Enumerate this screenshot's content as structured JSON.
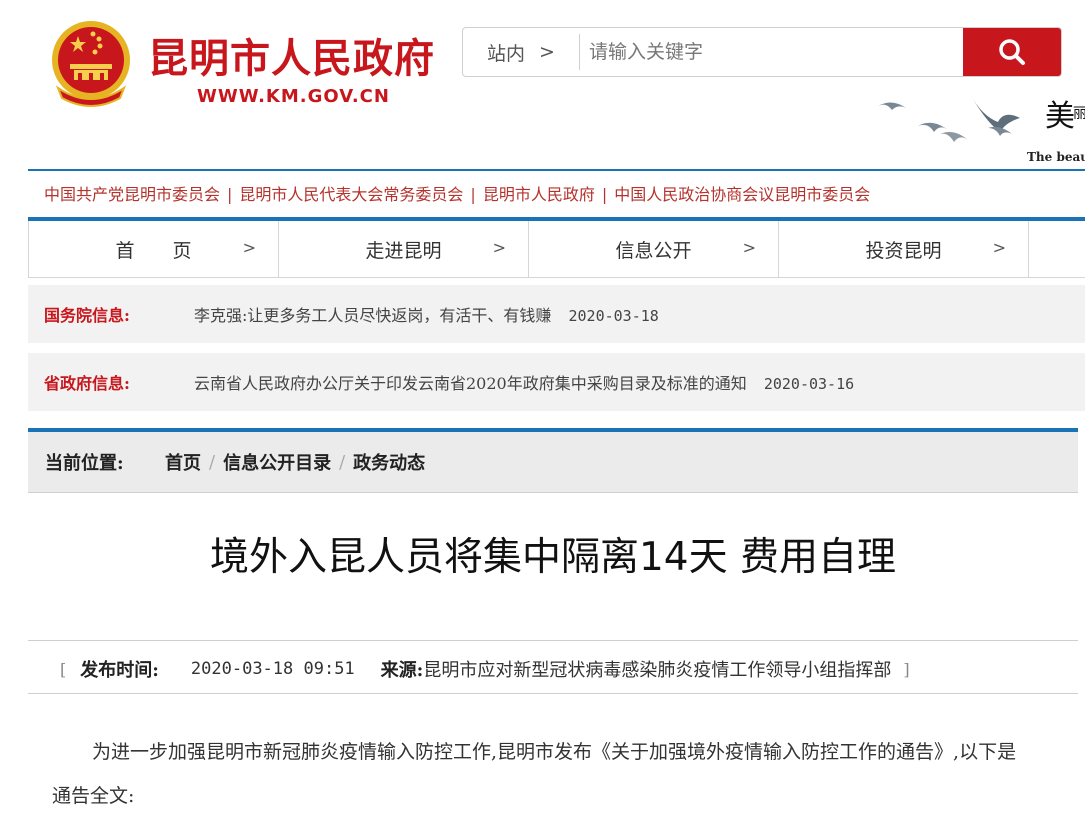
{
  "header": {
    "site_title": "昆明市人民政府",
    "site_url": "WWW.KM.GOV.CN",
    "tagline": "The beau",
    "search": {
      "scope_label": "站内",
      "scope_chevron": ">",
      "placeholder": "请输入关键字"
    }
  },
  "org_links": [
    "中国共产党昆明市委员会",
    "昆明市人民代表大会常务委员会",
    "昆明市人民政府",
    "中国人民政治协商会议昆明市委员会"
  ],
  "org_separator": "|",
  "nav": {
    "items": [
      "首　　页",
      "走进昆明",
      "信息公开",
      "投资昆明"
    ],
    "chevron": ">"
  },
  "info": [
    {
      "label": "国务院信息:",
      "text": "李克强:让更多务工人员尽快返岗，有活干、有钱赚",
      "date": "2020-03-18"
    },
    {
      "label": "省政府信息:",
      "text": "云南省人民政府办公厅关于印发云南省2020年政府集中采购目录及标准的通知",
      "date": "2020-03-16"
    }
  ],
  "breadcrumb": {
    "label": "当前位置:",
    "items": [
      "首页",
      "信息公开目录",
      "政务动态"
    ],
    "separator": "/"
  },
  "article": {
    "title": "境外入昆人员将集中隔离14天 费用自理",
    "meta": {
      "open_bracket": "[",
      "publish_label": "发布时间:",
      "publish_time": "2020-03-18 09:51",
      "source_label": "来源:",
      "source": "昆明市应对新型冠状病毒感染肺炎疫情工作领导小组指挥部",
      "close_bracket": "]"
    },
    "body": "为进一步加强昆明市新冠肺炎疫情输入防控工作,昆明市发布《关于加强境外疫情输入防控工作的通告》,以下是通告全文:"
  },
  "colors": {
    "brand_red": "#c8161d",
    "nav_blue": "#1a73b5",
    "org_link": "#b5322c"
  }
}
